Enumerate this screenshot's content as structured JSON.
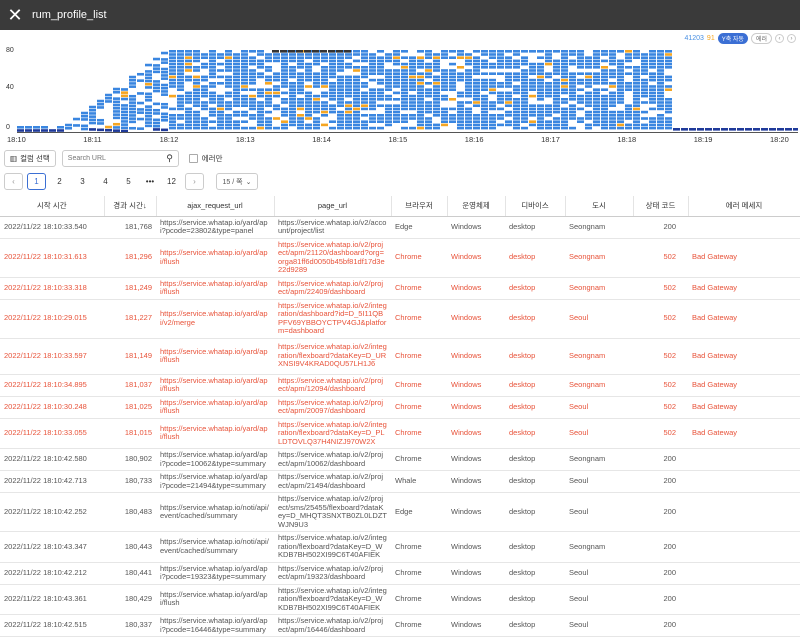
{
  "window": {
    "title": "rum_profile_list",
    "close_icon": "close-icon"
  },
  "chart": {
    "counts": {
      "total": "41203",
      "error": "91"
    },
    "y_auto_label": "Y축 자동",
    "error_toggle_label": "에러",
    "colors": {
      "normal": "#3a86e0",
      "error": "#f5a623",
      "dark": "#1f3a9a"
    }
  },
  "chart_data": {
    "type": "scatter",
    "y_ticks": [
      "80",
      "40",
      "0"
    ],
    "ylim": [
      0,
      80
    ],
    "x_ticks": [
      "18:10",
      "18:11",
      "18:12",
      "18:13",
      "18:14",
      "18:15",
      "18:16",
      "18:17",
      "18:18",
      "18:19",
      "18:20"
    ],
    "xlim": [
      "18:10",
      "18:20"
    ],
    "series": [
      {
        "name": "",
        "note": "request duration heatmap, blue = normal, orange = error"
      }
    ]
  },
  "toolbar": {
    "column_select_label": "컬럼 선택",
    "search_placeholder": "Search URL",
    "error_only_label": "에러만"
  },
  "pager": {
    "pages": [
      "1",
      "2",
      "3",
      "4",
      "5",
      "•••",
      "12"
    ],
    "per_page": "15 / 쪽"
  },
  "table": {
    "headers": [
      "시작 시간",
      "경과 시간↓",
      "ajax_request_url",
      "page_url",
      "브라우저",
      "운영체제",
      "디바이스",
      "도시",
      "상태 코드",
      "에러 메세지"
    ],
    "rows": [
      {
        "err": false,
        "cells": [
          "2022/11/22 18:10:33.540",
          "181,768",
          "https://service.whatap.io/yard/api?pcode=23802&type=panel",
          "https://service.whatap.io/v2/account/project/list",
          "Edge",
          "Windows",
          "desktop",
          "Seongnam",
          "200",
          ""
        ]
      },
      {
        "err": true,
        "cells": [
          "2022/11/22 18:10:31.613",
          "181,296",
          "https://service.whatap.io/yard/api/flush",
          "https://service.whatap.io/v2/project/apm/21120/dashboard?org=orga81ff6d0050b45bf81df17d3e22d9289",
          "Chrome",
          "Windows",
          "desktop",
          "Seongnam",
          "502",
          "Bad Gateway"
        ]
      },
      {
        "err": true,
        "cells": [
          "2022/11/22 18:10:33.318",
          "181,249",
          "https://service.whatap.io/yard/api/flush",
          "https://service.whatap.io/v2/project/apm/22409/dashboard",
          "Chrome",
          "Windows",
          "desktop",
          "Seongnam",
          "502",
          "Bad Gateway"
        ]
      },
      {
        "err": true,
        "cells": [
          "2022/11/22 18:10:29.015",
          "181,227",
          "https://service.whatap.io/yard/api/v2/merge",
          "https://service.whatap.io/v2/integration/dashboard?id=D_5I11QBPFV69YBBOYCTPV4GJ&platform=dashboard",
          "Chrome",
          "Windows",
          "desktop",
          "Seoul",
          "502",
          "Bad Gateway"
        ]
      },
      {
        "err": true,
        "cells": [
          "2022/11/22 18:10:33.597",
          "181,149",
          "https://service.whatap.io/yard/api/flush",
          "https://service.whatap.io/v2/integration/flexboard?dataKey=D_URXNSI9V4KRAD0QU57LH1J6",
          "Chrome",
          "Windows",
          "desktop",
          "Seongnam",
          "502",
          "Bad Gateway"
        ]
      },
      {
        "err": true,
        "cells": [
          "2022/11/22 18:10:34.895",
          "181,037",
          "https://service.whatap.io/yard/api/flush",
          "https://service.whatap.io/v2/project/apm/12094/dashboard",
          "Chrome",
          "Windows",
          "desktop",
          "Seongnam",
          "502",
          "Bad Gateway"
        ]
      },
      {
        "err": true,
        "cells": [
          "2022/11/22 18:10:30.248",
          "181,025",
          "https://service.whatap.io/yard/api/flush",
          "https://service.whatap.io/v2/project/apm/20097/dashboard",
          "Chrome",
          "Windows",
          "desktop",
          "Seoul",
          "502",
          "Bad Gateway"
        ]
      },
      {
        "err": true,
        "cells": [
          "2022/11/22 18:10:33.055",
          "181,015",
          "https://service.whatap.io/yard/api/flush",
          "https://service.whatap.io/v2/integration/flexboard?dataKey=D_PLLDTOVLQ37H4NIZJ970W2X",
          "Chrome",
          "Windows",
          "desktop",
          "Seoul",
          "502",
          "Bad Gateway"
        ]
      },
      {
        "err": false,
        "cells": [
          "2022/11/22 18:10:42.580",
          "180,902",
          "https://service.whatap.io/yard/api?pcode=10062&type=summary",
          "https://service.whatap.io/v2/project/apm/10062/dashboard",
          "Chrome",
          "Windows",
          "desktop",
          "Seongnam",
          "200",
          ""
        ]
      },
      {
        "err": false,
        "cells": [
          "2022/11/22 18:10:42.713",
          "180,733",
          "https://service.whatap.io/yard/api?pcode=21494&type=summary",
          "https://service.whatap.io/v2/project/apm/21494/dashboard",
          "Whale",
          "Windows",
          "desktop",
          "Seoul",
          "200",
          ""
        ]
      },
      {
        "err": false,
        "cells": [
          "2022/11/22 18:10:42.252",
          "180,483",
          "https://service.whatap.io/noti/api/event/cached/summary",
          "https://service.whatap.io/v2/project/sms/25455/flexboard?dataKey=D_MHQT3SNXTB0ZL0LDZTWJN9U3",
          "Edge",
          "Windows",
          "desktop",
          "Seoul",
          "200",
          ""
        ]
      },
      {
        "err": false,
        "cells": [
          "2022/11/22 18:10:43.347",
          "180,443",
          "https://service.whatap.io/noti/api/event/cached/summary",
          "https://service.whatap.io/v2/integration/flexboard?dataKey=D_WKDB7BH502XI99C6T40AFIEK",
          "Chrome",
          "Windows",
          "desktop",
          "Seongnam",
          "200",
          ""
        ]
      },
      {
        "err": false,
        "cells": [
          "2022/11/22 18:10:42.212",
          "180,441",
          "https://service.whatap.io/yard/api?pcode=19323&type=summary",
          "https://service.whatap.io/v2/project/apm/19323/dashboard",
          "Chrome",
          "Windows",
          "desktop",
          "Seoul",
          "200",
          ""
        ]
      },
      {
        "err": false,
        "cells": [
          "2022/11/22 18:10:43.361",
          "180,429",
          "https://service.whatap.io/yard/api/flush",
          "https://service.whatap.io/v2/integration/flexboard?dataKey=D_WKDB7BH502XI99C6T40AFIEK",
          "Chrome",
          "Windows",
          "desktop",
          "Seoul",
          "200",
          ""
        ]
      },
      {
        "err": false,
        "cells": [
          "2022/11/22 18:10:42.515",
          "180,337",
          "https://service.whatap.io/yard/api?pcode=16446&type=summary",
          "https://service.whatap.io/v2/project/apm/16446/dashboard",
          "Chrome",
          "Windows",
          "desktop",
          "Seoul",
          "200",
          ""
        ]
      }
    ]
  }
}
